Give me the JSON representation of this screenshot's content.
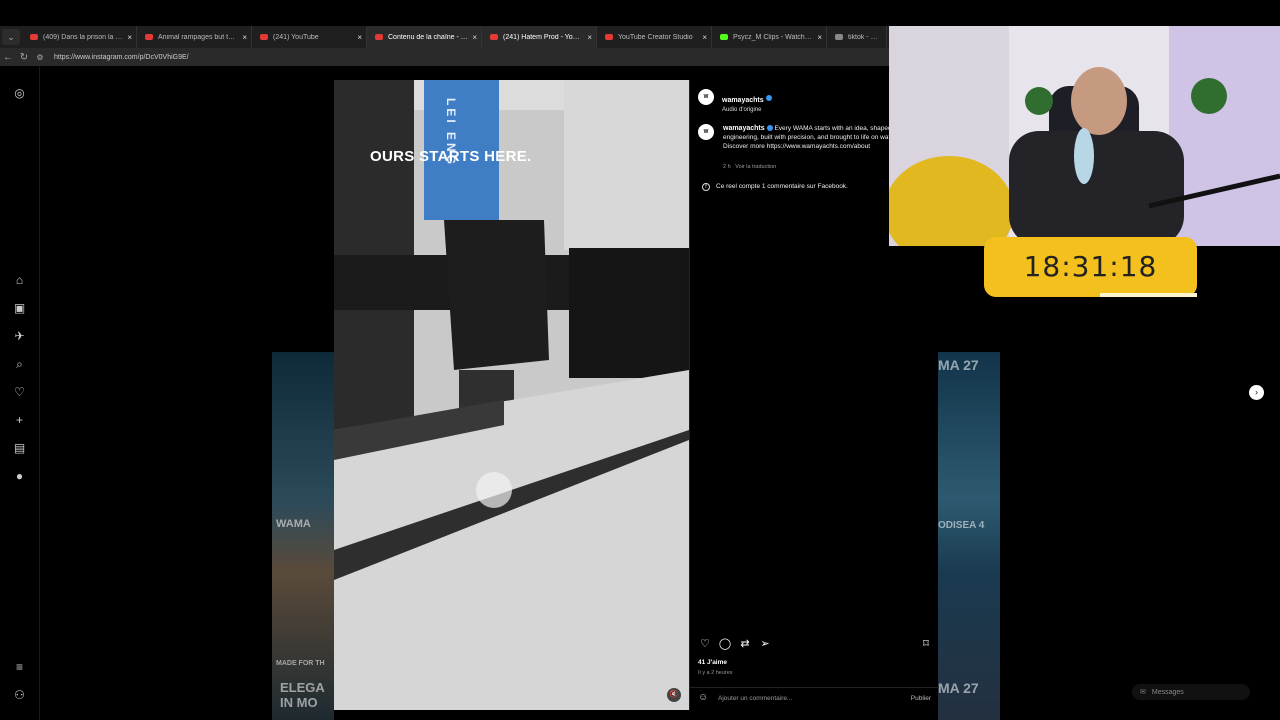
{
  "browser": {
    "tabs": [
      {
        "title": "(409) Dans la prison la plus surp",
        "favicon_color": "#e53935",
        "active": false
      },
      {
        "title": "Animal rampages but they get n",
        "favicon_color": "#e53935",
        "active": false
      },
      {
        "title": "(241) YouTube",
        "favicon_color": "#e53935",
        "active": false
      },
      {
        "title": "Contenu de la chaîne - YouTube",
        "favicon_color": "#e53935",
        "active": true
      },
      {
        "title": "(241) Hatem Prod - YouTube",
        "favicon_color": "#e53935",
        "active": true
      },
      {
        "title": "YouTube Creator Studio",
        "favicon_color": "#e53935",
        "active": false
      },
      {
        "title": "Psycz_M Clips - Watch Live on K",
        "favicon_color": "#53fc18",
        "active": false
      },
      {
        "title": "tiktok - Recherche",
        "favicon_color": "#888888",
        "active": false
      }
    ],
    "url": "https://www.instagram.com/p/DcV0VhiG9E/"
  },
  "video": {
    "caption": "OURS STARTS HERE.",
    "sign_text": "LEI  ENG"
  },
  "post": {
    "username": "wamayachts",
    "audio": "Audio d'origine",
    "avatar_text": "W",
    "description_lead": "Every WAMA starts with an idea, shaped by engineering, built with precision, and brought to life on water.",
    "description_more": "Discover more https://www.wamayachts.com/about",
    "time": "2 h",
    "translate": "Voir la traduction",
    "facebook_line": "Ce reel compte 1 commentaire sur Facebook.",
    "likes": "41 J'aime",
    "ago": "Il y a 2 heures",
    "comment_placeholder": "Ajouter un commentaire...",
    "publish": "Publier"
  },
  "thumbs": {
    "left_top": "WAMA",
    "left_mid": "MADE FOR TH",
    "left_big": "ELEGA IN MO",
    "right_top": "MA 27",
    "right_mid": "ODISEA 4",
    "right_bottom": "MA 27"
  },
  "sidebar": {
    "icons": [
      "instagram-icon",
      "home-icon",
      "reels-icon",
      "messenger-icon",
      "search-icon",
      "heart-icon",
      "plus-icon",
      "dashboard-icon",
      "profile-icon",
      "menu-icon",
      "threads-icon"
    ]
  },
  "messages": {
    "label": "Messages"
  },
  "timer": {
    "value": "18:31:18"
  }
}
